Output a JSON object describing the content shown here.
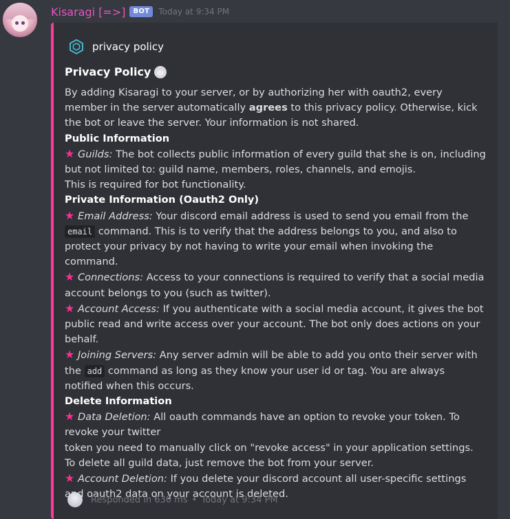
{
  "message": {
    "username": "Kisaragi [=>]",
    "bot_tag": "BOT",
    "timestamp": "Today at 9:34 PM"
  },
  "embed": {
    "accent_color": "#ff3a9a",
    "author": "privacy policy",
    "title": "Privacy Policy",
    "intro_1": "By adding Kisaragi to your server, or by authorizing her with oauth2, every member in the server automatically ",
    "intro_bold": "agrees",
    "intro_2": " to this privacy policy. Otherwise, kick the bot or leave the server. Your information is not shared.",
    "public_heading": "Public Information",
    "guilds_label": "Guilds:",
    "guilds_text": " The bot collects public information of every guild that she is on, including but not limited to: guild name, members, roles, channels, and emojis.",
    "guilds_note": "This is required for bot functionality.",
    "private_heading": "Private Information (Oauth2 Only)",
    "email_label": "Email Address:",
    "email_text_1": " Your discord email address is used to send you email from the ",
    "email_code": "email",
    "email_text_2": " command. This is to verify that the address belongs to you, and also to protect your privacy by not having to write your email when invoking the command.",
    "connections_label": "Connections:",
    "connections_text": " Access to your connections is required to verify that a social media account belongs to you (such as twitter).",
    "account_access_label": "Account Access:",
    "account_access_text": " If you authenticate with a social media account, it gives the bot public read and write access over your account. The bot only does actions on your behalf.",
    "joining_label": "Joining Servers:",
    "joining_text_1": " Any server admin will be able to add you onto their server with the ",
    "joining_code": "add",
    "joining_text_2": " command as long as they know your user id or tag. You are always notified when this occurs.",
    "delete_heading": "Delete Information",
    "data_deletion_label": "Data Deletion:",
    "data_deletion_text": " All oauth commands have an option to revoke your token. To revoke your twitter",
    "data_deletion_text_2": "token you need to manually click on \"revoke access\" in your application settings. To delete all guild data, just remove the bot from your server.",
    "account_deletion_label": "Account Deletion:",
    "account_deletion_text": " If you delete your discord account all user-specific settings and oauth2 data on your account is deleted.",
    "star": "★",
    "footer_text": "Responded in 630 ms",
    "footer_sep": "•",
    "footer_time": "Today at 9:34 PM"
  }
}
